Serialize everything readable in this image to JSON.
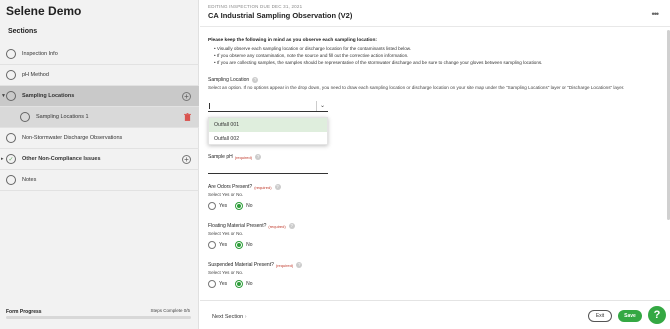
{
  "app": {
    "title": "Selene Demo"
  },
  "sidebar": {
    "sections_label": "Sections",
    "items": [
      {
        "label": "Inspection Info",
        "bold": false
      },
      {
        "label": "pH Method",
        "bold": false
      },
      {
        "label": "Sampling Locations",
        "bold": true
      },
      {
        "label": "Sampling Locations 1",
        "bold": false
      },
      {
        "label": "Non-Stormwater Discharge Observations",
        "bold": false
      },
      {
        "label": "Other Non-Compliance Issues",
        "bold": true
      },
      {
        "label": "Notes",
        "bold": false
      }
    ],
    "progress_label": "Form Progress",
    "steps_label": "Steps Complete 0/5",
    "progress_fraction": 0
  },
  "header": {
    "editing_label": "EDITING INSPECTION DUE DEC 31, 2021",
    "form_title": "CA Industrial Sampling Observation (V2)",
    "more_icon": "more-horizontal-icon"
  },
  "instructions": {
    "intro": "Please keep the following in mind as you observe each sampling location:",
    "bullets": [
      "Visually observe each sampling location or discharge location for the contaminants listed below.",
      "If you observe any contamination, note the source and fill out the corrective action information.",
      "If you are collecting samples, the samples should be representative of the stormwater discharge and be sure to change your gloves between sampling locations."
    ]
  },
  "sampling_location": {
    "label": "Sampling Location",
    "help_text": "Select an option. If no options appear in the drop down, you need to draw each sampling location or discharge location on your site map under the \"Sampling Locations\" layer or \"Discharge Locations\" layer.",
    "options": [
      "Outfall 001",
      "Outfall 002"
    ],
    "highlighted_index": 0
  },
  "sample_ph": {
    "label": "Sample pH",
    "required": "(required)"
  },
  "questions": [
    {
      "label": "Are Odors Present?",
      "required": "(required)",
      "help": "Select Yes or No.",
      "yes": "Yes",
      "no": "No",
      "selected": "No"
    },
    {
      "label": "Floating Material Present?",
      "required": "(required)",
      "help": "Select Yes or No.",
      "yes": "Yes",
      "no": "No",
      "selected": "No"
    },
    {
      "label": "Suspended Material Present?",
      "required": "(required)",
      "help": "Select Yes or No.",
      "yes": "Yes",
      "no": "No",
      "selected": "No"
    }
  ],
  "footer": {
    "next_section": "Next Section",
    "exit": "Exit",
    "save": "Save",
    "help_icon": "?"
  },
  "colors": {
    "accent": "#34a843",
    "required": "#c0392b",
    "sidebar_bg": "#f2f2f2",
    "active_bg": "#c9c9c9"
  }
}
